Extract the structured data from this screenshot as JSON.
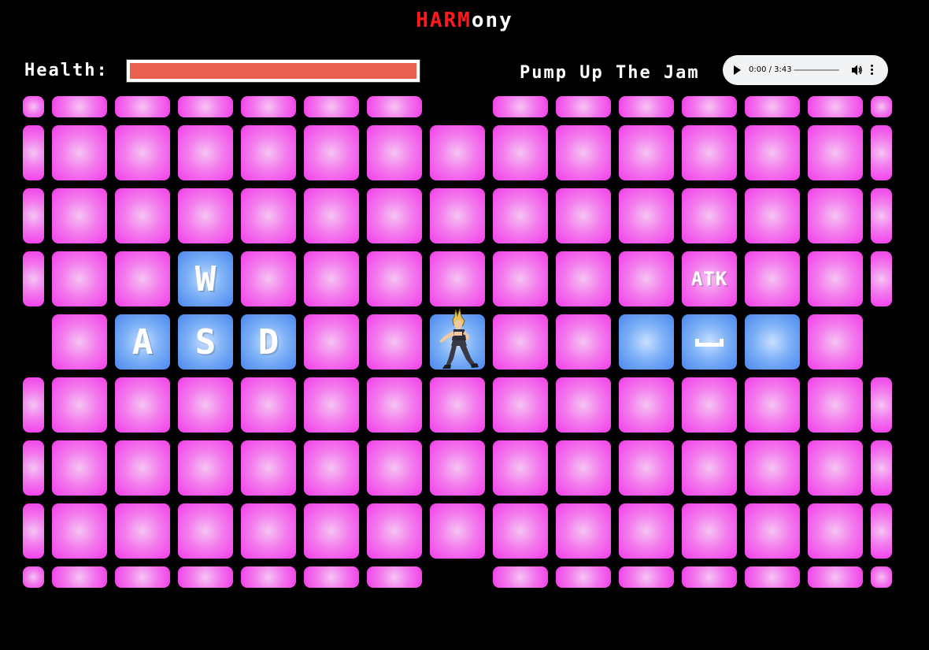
{
  "title": {
    "part1": "HARM",
    "part2": "ony"
  },
  "health": {
    "label": "Health:",
    "value_fraction": 1.0
  },
  "song": {
    "name": "Pump Up The Jam"
  },
  "audio": {
    "time": "0:00 / 3:43"
  },
  "board": {
    "columns": 15,
    "rows": 10,
    "key_tiles": [
      {
        "row": 3,
        "col": 3,
        "label": "W",
        "kind": "key"
      },
      {
        "row": 4,
        "col": 2,
        "label": "A",
        "kind": "key"
      },
      {
        "row": 4,
        "col": 3,
        "label": "S",
        "kind": "key"
      },
      {
        "row": 4,
        "col": 4,
        "label": "D",
        "kind": "key"
      },
      {
        "row": 3,
        "col": 11,
        "label": "ATK",
        "kind": "text"
      },
      {
        "row": 4,
        "col": 10,
        "label": "",
        "kind": "blue"
      },
      {
        "row": 4,
        "col": 11,
        "label": "space",
        "kind": "space"
      },
      {
        "row": 4,
        "col": 12,
        "label": "",
        "kind": "blue"
      }
    ],
    "player": {
      "row": 4,
      "col": 7
    },
    "colors": {
      "tile": "#f23ee9",
      "highlight": "#4a87ee",
      "background": "#000000"
    }
  }
}
